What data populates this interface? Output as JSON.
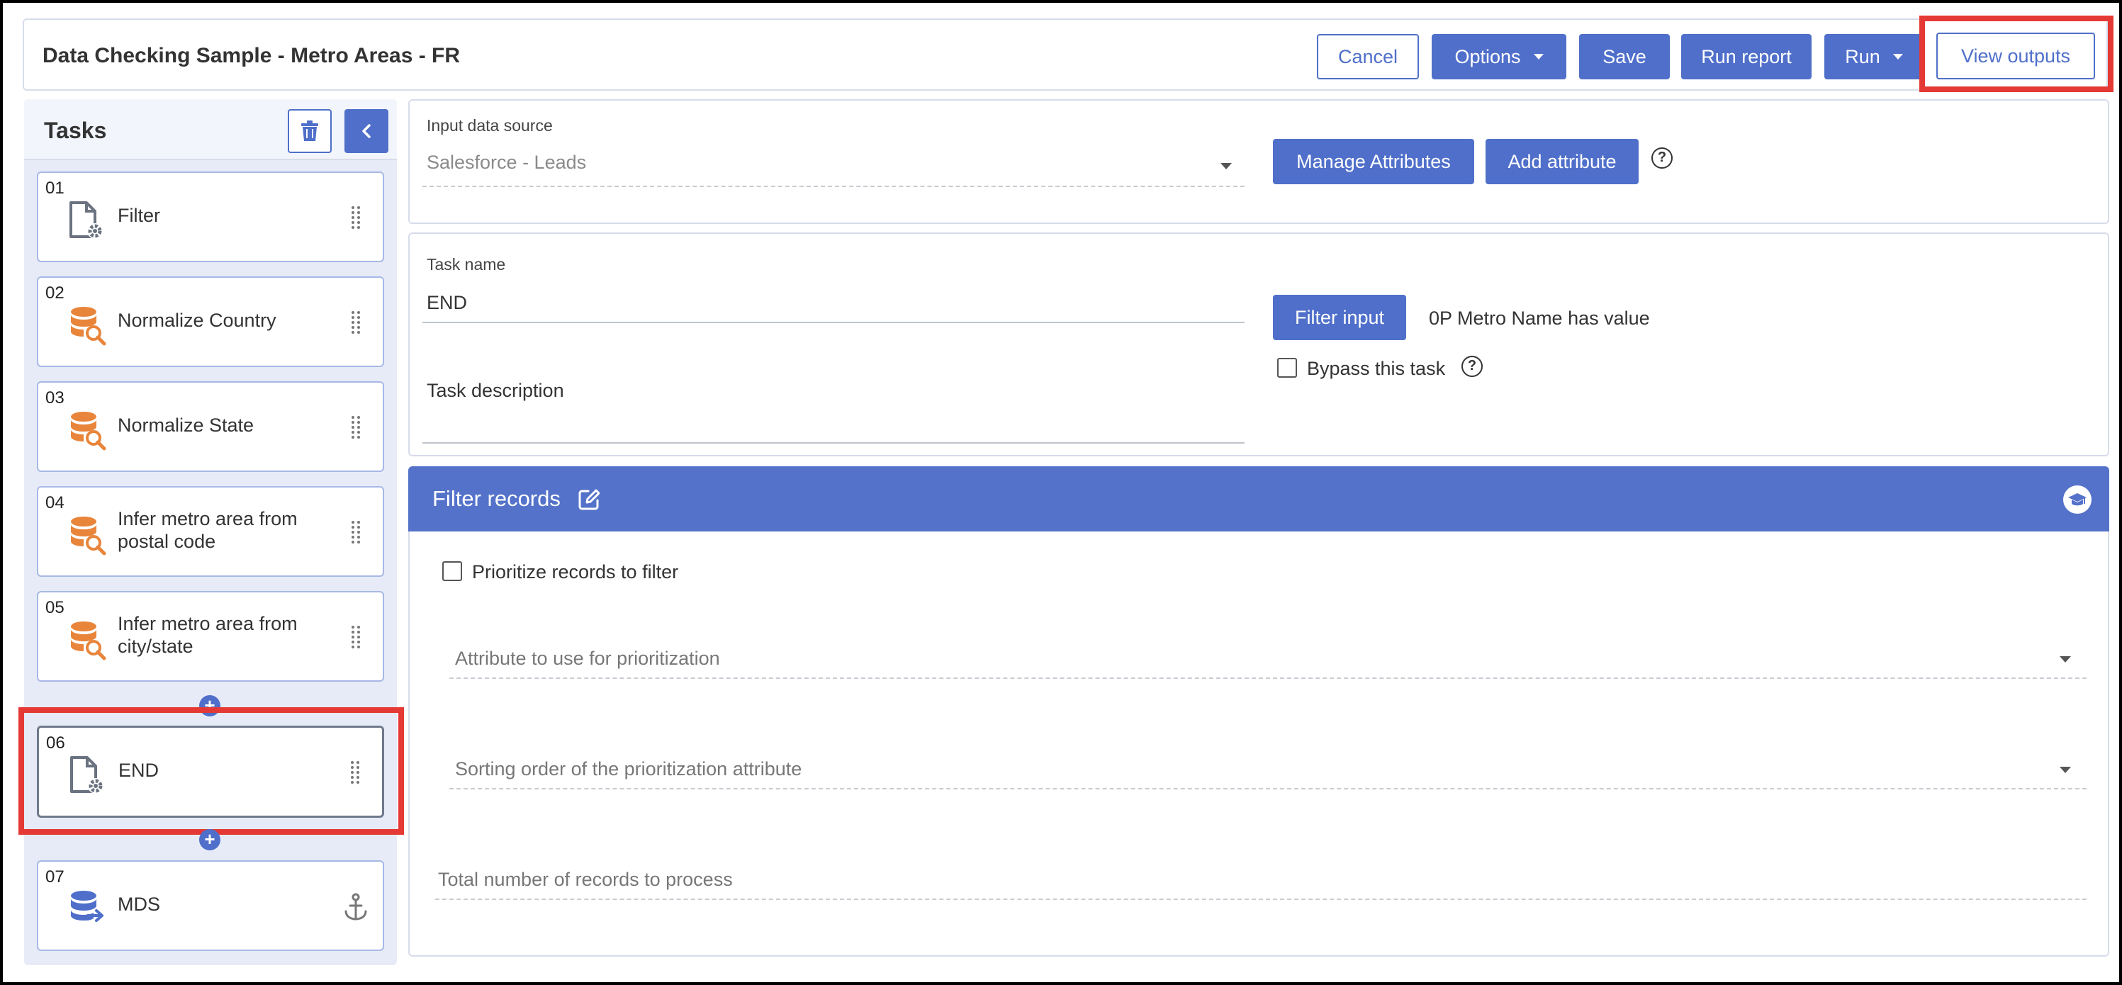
{
  "header": {
    "title": "Data Checking Sample - Metro Areas - FR",
    "buttons": {
      "cancel": "Cancel",
      "options": "Options",
      "save": "Save",
      "run_report": "Run report",
      "run": "Run",
      "view_outputs": "View outputs"
    }
  },
  "sidebar": {
    "title": "Tasks",
    "tasks": [
      {
        "num": "01",
        "label": "Filter",
        "icon": "file-gear-icon"
      },
      {
        "num": "02",
        "label": "Normalize Country",
        "icon": "database-search-icon"
      },
      {
        "num": "03",
        "label": "Normalize State",
        "icon": "database-search-icon"
      },
      {
        "num": "04",
        "label": "Infer metro area from postal code",
        "icon": "database-search-icon"
      },
      {
        "num": "05",
        "label": "Infer metro area from city/state",
        "icon": "database-search-icon"
      },
      {
        "num": "06",
        "label": "END",
        "icon": "file-gear-icon",
        "selected": true
      },
      {
        "num": "07",
        "label": "MDS",
        "icon": "database-export-icon"
      }
    ]
  },
  "source_panel": {
    "input_label": "Input data source",
    "input_value": "Salesforce - Leads",
    "manage_attributes": "Manage Attributes",
    "add_attribute": "Add attribute"
  },
  "task_panel": {
    "task_name_label": "Task name",
    "task_name_value": "END",
    "task_description_label": "Task description",
    "filter_input_button": "Filter input",
    "filter_input_value": "0P Metro Name has value",
    "bypass_label": "Bypass this task"
  },
  "filter_records": {
    "title": "Filter records",
    "prioritize_label": "Prioritize records to filter",
    "attribute_placeholder": "Attribute to use for prioritization",
    "sorting_placeholder": "Sorting order of the prioritization attribute",
    "total_placeholder": "Total number of records to process"
  },
  "colors": {
    "primary": "#4f6fca",
    "highlight": "#e53935",
    "sidebar_bg": "#e6ebf7",
    "orange_icon": "#e8853b"
  }
}
